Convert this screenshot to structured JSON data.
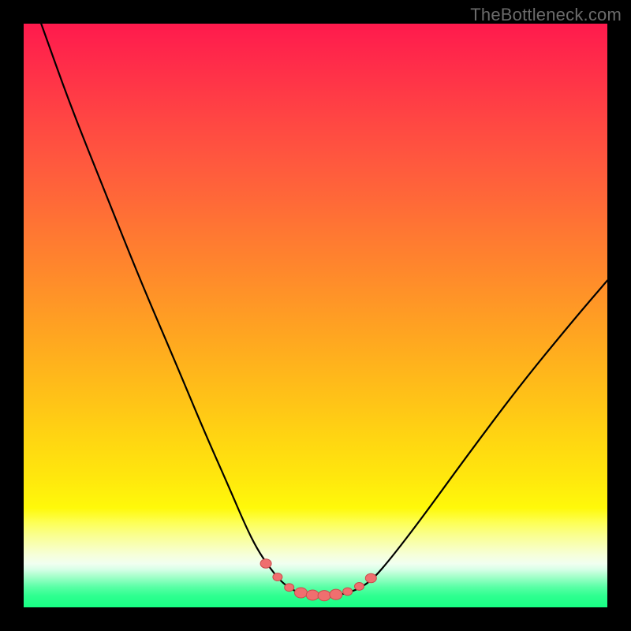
{
  "watermark": "TheBottleneck.com",
  "colors": {
    "frame": "#000000",
    "curve_stroke": "#000000",
    "marker_fill": "#ef6f6f",
    "marker_stroke": "#c94d4d",
    "gradient_stops": [
      "#ff1a4d",
      "#ff4a42",
      "#ff872c",
      "#ffc716",
      "#fff90a",
      "#f6ffd9",
      "#aeffcf",
      "#2fff90",
      "#17ff84"
    ]
  },
  "chart_data": {
    "type": "line",
    "title": "",
    "xlabel": "",
    "ylabel": "",
    "xlim": [
      0,
      100
    ],
    "ylim": [
      0,
      100
    ],
    "grid": false,
    "legend": false,
    "series": [
      {
        "name": "bottleneck-curve",
        "x": [
          3,
          8,
          14,
          20,
          26,
          31,
          35,
          38,
          40,
          42,
          44,
          46,
          48,
          50,
          52,
          54,
          56,
          58,
          60,
          63,
          68,
          76,
          85,
          94,
          100
        ],
        "y": [
          100,
          86,
          71,
          56,
          42,
          30,
          21,
          14,
          10,
          7,
          4.5,
          3,
          2.2,
          2,
          2,
          2.1,
          2.6,
          3.5,
          5,
          8.5,
          15,
          26,
          38,
          49,
          56
        ]
      }
    ],
    "markers": {
      "name": "highlight-points",
      "x": [
        41.5,
        43.5,
        45.5,
        47.5,
        49.5,
        51.5,
        53.5,
        55.5,
        57.5,
        59.5
      ],
      "y": [
        7.5,
        5.2,
        3.4,
        2.5,
        2.1,
        2.0,
        2.2,
        2.7,
        3.6,
        5.0
      ],
      "r": [
        7,
        6,
        6,
        8,
        8,
        8,
        8,
        6,
        6,
        7
      ]
    }
  }
}
